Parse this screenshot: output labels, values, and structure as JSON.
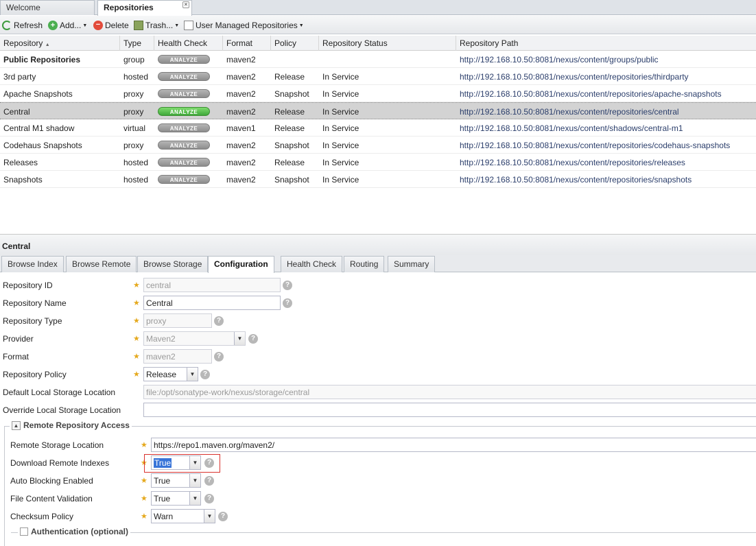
{
  "tabs": [
    {
      "label": "Welcome"
    },
    {
      "label": "Repositories"
    }
  ],
  "toolbar": {
    "refresh": "Refresh",
    "add": "Add...",
    "delete": "Delete",
    "trash": "Trash...",
    "user_managed": "User Managed Repositories"
  },
  "grid": {
    "columns": [
      "Repository",
      "Type",
      "Health Check",
      "Format",
      "Policy",
      "Repository Status",
      "Repository Path"
    ],
    "sort_indicator": "▲",
    "analyze_label": "ANALYZE",
    "rows": [
      {
        "name": "Public Repositories",
        "type": "group",
        "format": "maven2",
        "policy": "",
        "status": "",
        "path": "http://192.168.10.50:8081/nexus/content/groups/public"
      },
      {
        "name": "3rd party",
        "type": "hosted",
        "format": "maven2",
        "policy": "Release",
        "status": "In Service",
        "path": "http://192.168.10.50:8081/nexus/content/repositories/thirdparty"
      },
      {
        "name": "Apache Snapshots",
        "type": "proxy",
        "format": "maven2",
        "policy": "Snapshot",
        "status": "In Service",
        "path": "http://192.168.10.50:8081/nexus/content/repositories/apache-snapshots"
      },
      {
        "name": "Central",
        "type": "proxy",
        "format": "maven2",
        "policy": "Release",
        "status": "In Service",
        "path": "http://192.168.10.50:8081/nexus/content/repositories/central"
      },
      {
        "name": "Central M1 shadow",
        "type": "virtual",
        "format": "maven1",
        "policy": "Release",
        "status": "In Service",
        "path": "http://192.168.10.50:8081/nexus/content/shadows/central-m1"
      },
      {
        "name": "Codehaus Snapshots",
        "type": "proxy",
        "format": "maven2",
        "policy": "Snapshot",
        "status": "In Service",
        "path": "http://192.168.10.50:8081/nexus/content/repositories/codehaus-snapshots"
      },
      {
        "name": "Releases",
        "type": "hosted",
        "format": "maven2",
        "policy": "Release",
        "status": "In Service",
        "path": "http://192.168.10.50:8081/nexus/content/repositories/releases"
      },
      {
        "name": "Snapshots",
        "type": "hosted",
        "format": "maven2",
        "policy": "Snapshot",
        "status": "In Service",
        "path": "http://192.168.10.50:8081/nexus/content/repositories/snapshots"
      }
    ]
  },
  "panel": {
    "title": "Central",
    "tabs": [
      "Browse Index",
      "Browse Remote",
      "Browse Storage",
      "Configuration",
      "Health Check",
      "Routing",
      "Summary"
    ]
  },
  "form": {
    "repo_id": {
      "label": "Repository ID",
      "value": "central"
    },
    "repo_name": {
      "label": "Repository Name",
      "value": "Central"
    },
    "repo_type": {
      "label": "Repository Type",
      "value": "proxy"
    },
    "provider": {
      "label": "Provider",
      "value": "Maven2"
    },
    "format": {
      "label": "Format",
      "value": "maven2"
    },
    "policy": {
      "label": "Repository Policy",
      "value": "Release"
    },
    "default_storage": {
      "label": "Default Local Storage Location",
      "value": "file:/opt/sonatype-work/nexus/storage/central"
    },
    "override_storage": {
      "label": "Override Local Storage Location",
      "value": ""
    },
    "remote_section": "Remote Repository Access",
    "remote_location": {
      "label": "Remote Storage Location",
      "value": "https://repo1.maven.org/maven2/"
    },
    "download_indexes": {
      "label": "Download Remote Indexes",
      "value": "True"
    },
    "auto_blocking": {
      "label": "Auto Blocking Enabled",
      "value": "True"
    },
    "file_validation": {
      "label": "File Content Validation",
      "value": "True"
    },
    "checksum_policy": {
      "label": "Checksum Policy",
      "value": "Warn"
    },
    "auth_section": "Authentication (optional)"
  },
  "icons": {
    "help": "?",
    "select_arrow": "▼",
    "collapse": "▲",
    "tab_close": "×"
  },
  "colors": {
    "analyze_selected": "#3fa83a",
    "highlight": "#d9302c"
  }
}
